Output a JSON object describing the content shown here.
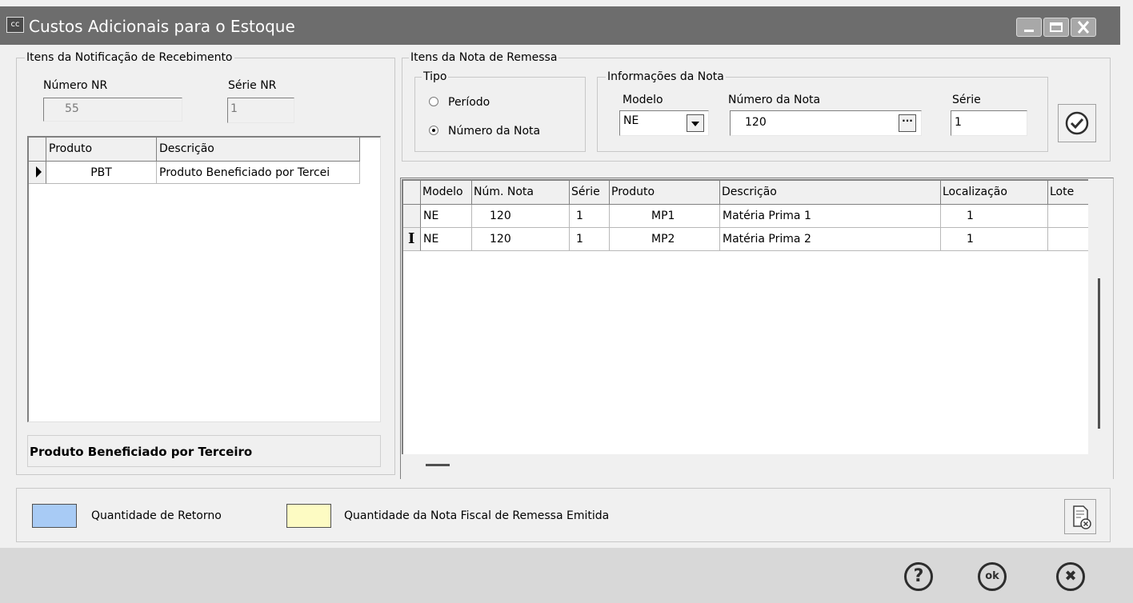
{
  "window": {
    "icon_text": "cc",
    "title": "Custos Adicionais para o Estoque",
    "controls": [
      "minimize-icon",
      "maximize-icon",
      "close-icon"
    ]
  },
  "nr_group": {
    "legend": "Itens da Notificação de Recebimento",
    "numero_nr_label": "Número NR",
    "numero_nr_value": "55",
    "serie_nr_label": "Série NR",
    "serie_nr_value": "1",
    "table": {
      "headers": [
        "Produto",
        "Descrição"
      ],
      "rows": [
        {
          "produto": "PBT",
          "descricao": "Produto Beneficiado por Tercei"
        }
      ]
    },
    "status_text": "Produto Beneficiado por Terceiro"
  },
  "remessa_group": {
    "legend": "Itens da Nota de Remessa",
    "tipo": {
      "legend": "Tipo",
      "options": [
        "Período",
        "Número da Nota"
      ],
      "selected": "Número da Nota"
    },
    "info": {
      "legend": "Informações da Nota",
      "modelo_label": "Modelo",
      "modelo_value": "NE",
      "numero_label": "Número da Nota",
      "numero_value": "120",
      "ellipsis": "···",
      "serie_label": "Série",
      "serie_value": "1"
    },
    "table": {
      "headers": [
        "Modelo",
        "Núm. Nota",
        "Série",
        "Produto",
        "Descrição",
        "Localização",
        "Lote"
      ],
      "rows": [
        {
          "modelo": "NE",
          "num_nota": "120",
          "serie": "1",
          "produto": "MP1",
          "descricao": "Matéria Prima 1",
          "localizacao": "1",
          "lote": ""
        },
        {
          "modelo": "NE",
          "num_nota": "120",
          "serie": "1",
          "produto": "MP2",
          "descricao": "Matéria Prima 2",
          "localizacao": "1",
          "lote": ""
        }
      ]
    }
  },
  "legend_bar": {
    "items": [
      {
        "label": "Quantidade de Retorno",
        "color": "#a8cbf5"
      },
      {
        "label": "Quantidade da Nota Fiscal de Remessa Emitida",
        "color": "#fdfbc3"
      }
    ]
  },
  "footer": {
    "help_symbol": "?",
    "ok_symbol": "ok",
    "cancel_symbol": "✖"
  }
}
